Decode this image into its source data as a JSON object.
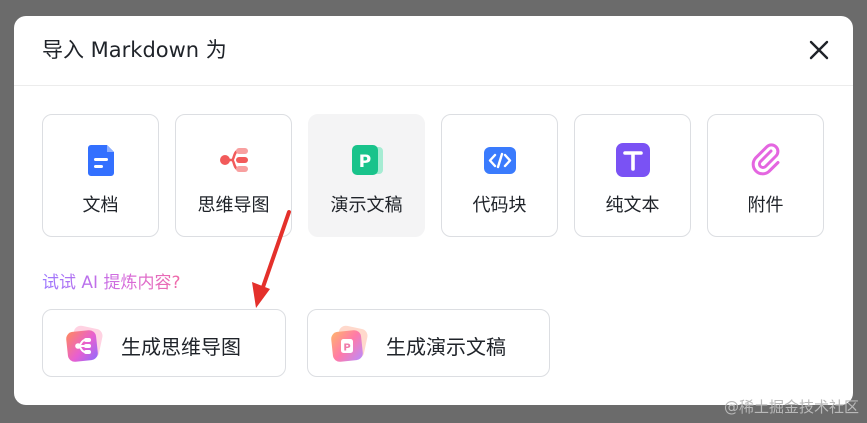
{
  "dialog": {
    "title": "导入 Markdown 为",
    "close_icon": "close-icon"
  },
  "import_options": [
    {
      "label": "文档",
      "icon": "doc-icon",
      "color": "#3370ff"
    },
    {
      "label": "思维导图",
      "icon": "mindmap-icon",
      "color": "#f25a5a"
    },
    {
      "label": "演示文稿",
      "icon": "slides-icon",
      "color": "#19c38b",
      "selected": true
    },
    {
      "label": "代码块",
      "icon": "code-block-icon",
      "color": "#3a7bfd"
    },
    {
      "label": "纯文本",
      "icon": "text-icon",
      "color": "#7a52f4"
    },
    {
      "label": "附件",
      "icon": "paperclip-icon",
      "color": "#e466e0"
    }
  ],
  "ai": {
    "hint": "试试 AI 提炼内容?",
    "buttons": [
      {
        "label": "生成思维导图",
        "icon": "ai-mindmap-icon"
      },
      {
        "label": "生成演示文稿",
        "icon": "ai-slides-icon"
      }
    ]
  },
  "annotation": {
    "arrow_color": "#e4302b"
  },
  "watermark": "@稀土掘金技术社区"
}
